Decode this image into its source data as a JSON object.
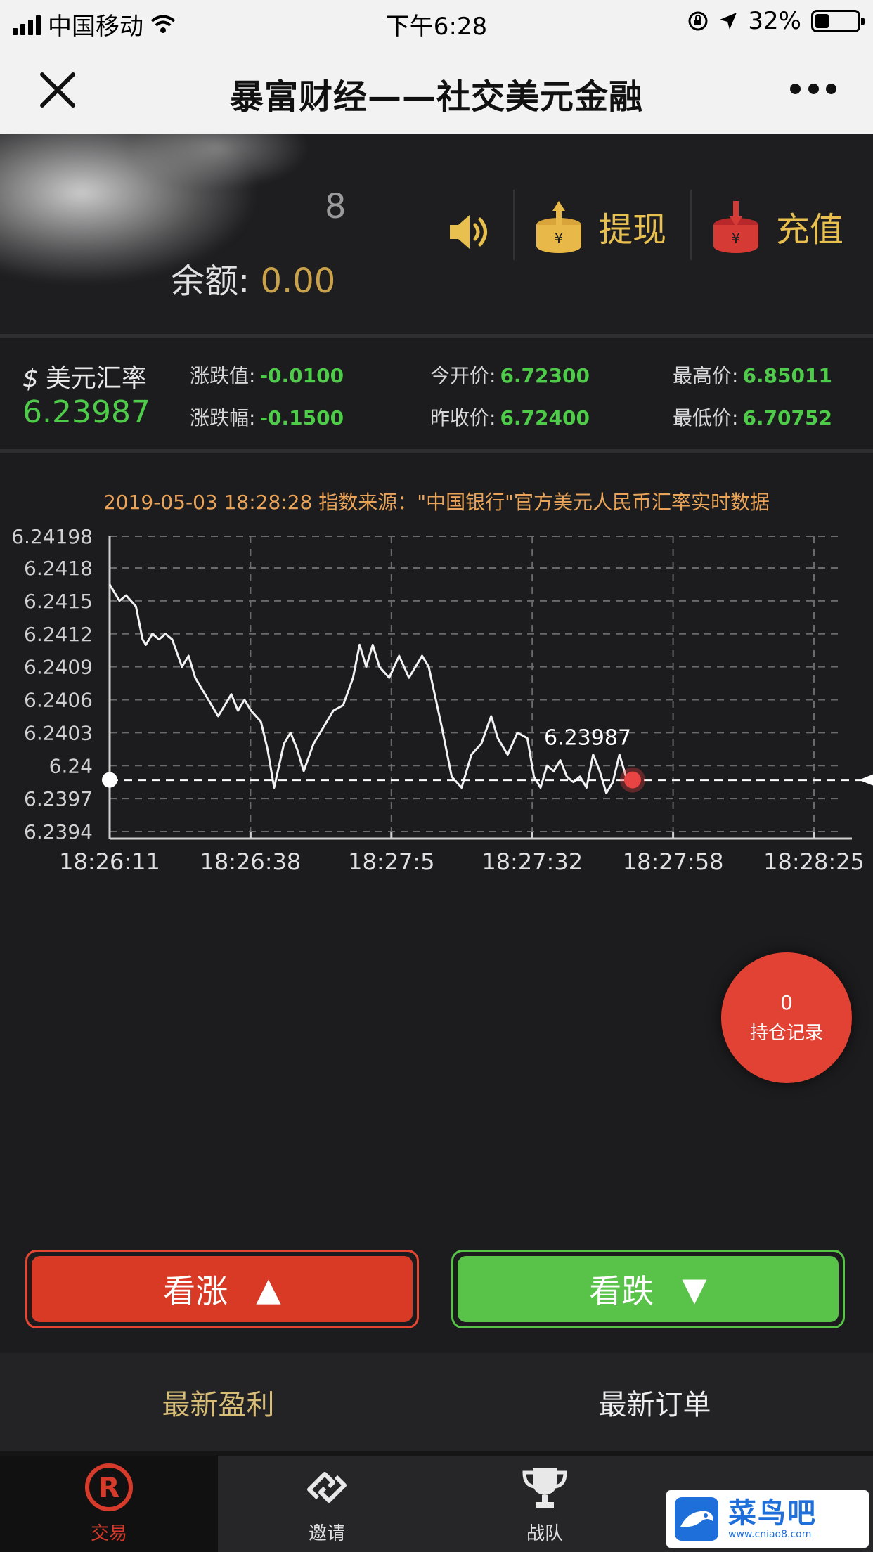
{
  "status_bar": {
    "carrier": "中国移动",
    "time": "下午6:28",
    "battery": "32%",
    "battery_level": 0.32
  },
  "nav": {
    "title": "暴富财经——社交美元金融",
    "close_icon": "close-icon",
    "more_icon": "more-icon"
  },
  "account": {
    "id_fragment": "8",
    "balance_label": "余额:",
    "balance_value": "0.00",
    "withdraw_label": "提现",
    "deposit_label": "充值",
    "speaker_icon": "speaker-icon",
    "accent_color": "#e8c04f"
  },
  "rates": {
    "name": "美元汇率",
    "currency_symbol": "$",
    "current": "6.23987",
    "change_label": "涨跌值:",
    "change_value": "-0.0100",
    "change_pct_label": "涨跌幅:",
    "change_pct_value": "-0.1500",
    "open_label": "今开价:",
    "open_value": "6.72300",
    "prev_close_label": "昨收价:",
    "prev_close_value": "6.72400",
    "high_label": "最高价:",
    "high_value": "6.85011",
    "low_label": "最低价:",
    "low_value": "6.70752",
    "value_color": "#4fcb4a"
  },
  "chart": {
    "source_text": "2019-05-03 18:28:28 指数来源：\"中国银行\"官方美元人民币汇率实时数据",
    "current_label": "6.23987",
    "hold_count": "0",
    "hold_label": "持仓记录"
  },
  "chart_data": {
    "type": "line",
    "title": "",
    "xlabel": "",
    "ylabel": "",
    "ylim": [
      6.2394,
      6.24198
    ],
    "y_ticks": [
      "6.24198",
      "6.2418",
      "6.2415",
      "6.2412",
      "6.2409",
      "6.2406",
      "6.2403",
      "6.24",
      "6.2397",
      "6.2394"
    ],
    "x_ticks": [
      "18:26:11",
      "18:26:38",
      "18:27:5",
      "18:27:32",
      "18:27:58",
      "18:28:25"
    ],
    "current_value": 6.23987,
    "grid": true,
    "series": [
      {
        "values": [
          [
            0,
            6.24165
          ],
          [
            3,
            6.2415
          ],
          [
            5,
            6.24155
          ],
          [
            8,
            6.24145
          ],
          [
            10,
            6.24115
          ],
          [
            11,
            6.2411
          ],
          [
            13,
            6.2412
          ],
          [
            15,
            6.24115
          ],
          [
            17,
            6.2412
          ],
          [
            19,
            6.24115
          ],
          [
            22,
            6.2409
          ],
          [
            24,
            6.241
          ],
          [
            26,
            6.2408
          ],
          [
            30,
            6.2406
          ],
          [
            33,
            6.24045
          ],
          [
            35,
            6.24055
          ],
          [
            37,
            6.24065
          ],
          [
            39,
            6.2405
          ],
          [
            41,
            6.2406
          ],
          [
            43,
            6.2405
          ],
          [
            46,
            6.2404
          ],
          [
            48,
            6.24015
          ],
          [
            50,
            6.2398
          ],
          [
            53,
            6.2402
          ],
          [
            55,
            6.2403
          ],
          [
            57,
            6.24015
          ],
          [
            59,
            6.23995
          ],
          [
            62,
            6.2402
          ],
          [
            65,
            6.24035
          ],
          [
            68,
            6.2405
          ],
          [
            71,
            6.24055
          ],
          [
            74,
            6.2408
          ],
          [
            76,
            6.2411
          ],
          [
            78,
            6.2409
          ],
          [
            80,
            6.2411
          ],
          [
            82,
            6.2409
          ],
          [
            85,
            6.2408
          ],
          [
            88,
            6.241
          ],
          [
            91,
            6.2408
          ],
          [
            93,
            6.2409
          ],
          [
            95,
            6.241
          ],
          [
            97,
            6.2409
          ],
          [
            101,
            6.24035
          ],
          [
            104,
            6.2399
          ],
          [
            107,
            6.2398
          ],
          [
            110,
            6.2401
          ],
          [
            113,
            6.2402
          ],
          [
            116,
            6.24045
          ],
          [
            118,
            6.24025
          ],
          [
            121,
            6.2401
          ],
          [
            124,
            6.2403
          ],
          [
            127,
            6.24025
          ],
          [
            129,
            6.2399
          ],
          [
            131,
            6.2398
          ],
          [
            133,
            6.24
          ],
          [
            135,
            6.23995
          ],
          [
            137,
            6.24005
          ],
          [
            139,
            6.2399
          ],
          [
            141,
            6.23985
          ],
          [
            143,
            6.2399
          ],
          [
            145,
            6.2398
          ],
          [
            147,
            6.2401
          ],
          [
            149,
            6.23995
          ],
          [
            151,
            6.23975
          ],
          [
            153,
            6.23985
          ],
          [
            155,
            6.2401
          ],
          [
            157,
            6.2399
          ],
          [
            159,
            6.23987
          ]
        ]
      }
    ]
  },
  "trade": {
    "up_label": "看涨",
    "up_arrow": "▲",
    "down_label": "看跌",
    "down_arrow": "▼",
    "up_color": "#d93a26",
    "down_color": "#58c249"
  },
  "tabs": {
    "profit": "最新盈利",
    "orders": "最新订单"
  },
  "bottom_nav": [
    {
      "label": "交易",
      "icon": "registered-icon",
      "active": true
    },
    {
      "label": "邀请",
      "icon": "link-icon",
      "active": false
    },
    {
      "label": "战队",
      "icon": "trophy-icon",
      "active": false
    },
    {
      "label": "",
      "icon": "profile-icon",
      "active": false
    }
  ],
  "watermark": {
    "brand": "菜鸟吧",
    "url": "www.cniao8.com"
  }
}
